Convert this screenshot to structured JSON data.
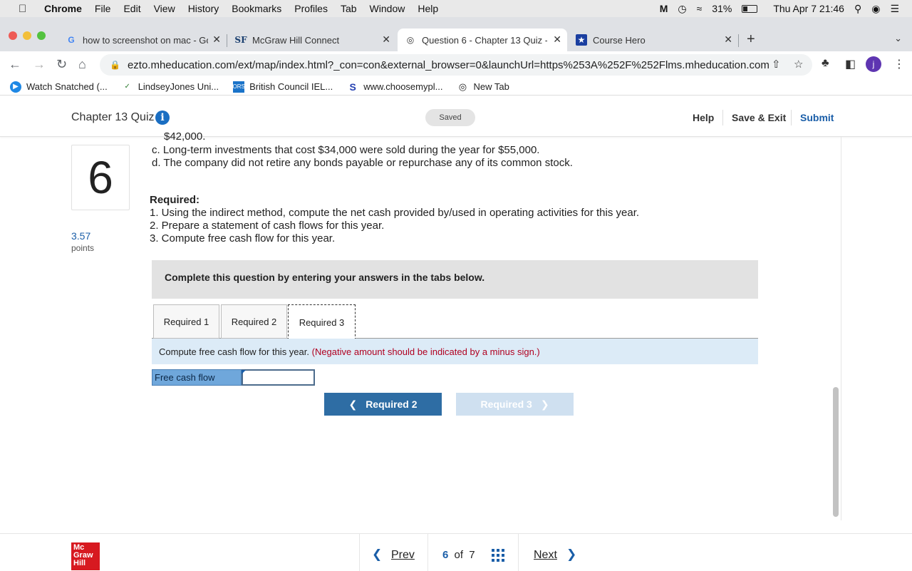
{
  "menubar": {
    "app": "Chrome",
    "items": [
      "File",
      "Edit",
      "View",
      "History",
      "Bookmarks",
      "Profiles",
      "Tab",
      "Window",
      "Help"
    ],
    "battery": "31%",
    "clock": "Thu Apr 7  21:46"
  },
  "browser": {
    "tabs": [
      {
        "title": "how to screenshot on mac - Go",
        "favicon": "G"
      },
      {
        "title": "McGraw Hill Connect",
        "favicon": "SF"
      },
      {
        "title": "Question 6 - Chapter 13 Quiz -",
        "favicon": "globe"
      },
      {
        "title": "Course Hero",
        "favicon": "star"
      }
    ],
    "url": "ezto.mheducation.com/ext/map/index.html?_con=con&external_browser=0&launchUrl=https%253A%252F%252Flms.mheducation.com...",
    "avatar_letter": "j",
    "bookmarks": [
      "Watch Snatched (...",
      "LindseyJones Uni...",
      "British Council IEL...",
      "www.choosemypl...",
      "New Tab"
    ],
    "bookmark_icons": [
      "ORS"
    ]
  },
  "quiz": {
    "title": "Chapter 13 Quiz",
    "saved_label": "Saved",
    "help": "Help",
    "save_exit": "Save & Exit",
    "submit": "Submit",
    "question_number": "6",
    "points_value": "3.57",
    "points_label": "points",
    "clipped_text": "$42,000.",
    "line_c": "c. Long-term investments that cost $34,000 were sold during the year for $55,000.",
    "line_d": "d. The company did not retire any bonds payable or repurchase any of its common stock.",
    "required_heading": "Required:",
    "required_1": "1. Using the indirect method, compute the net cash provided by/used in operating activities for this year.",
    "required_2": "2. Prepare a statement of cash flows for this year.",
    "required_3": "3. Compute free cash flow for this year.",
    "instruction": "Complete this question by entering your answers in the tabs below.",
    "tabs": [
      "Required 1",
      "Required 2",
      "Required 3"
    ],
    "prompt": "Compute free cash flow for this year.",
    "prompt_note": "(Negative amount should be indicated by a minus sign.)",
    "fcf_label": "Free cash flow",
    "fcf_value": "",
    "prev_tab_btn": "Required 2",
    "next_tab_btn": "Required 3"
  },
  "footer": {
    "logo": [
      "Mc",
      "Graw",
      "Hill"
    ],
    "prev": "Prev",
    "current": "6",
    "of": "of",
    "total": "7",
    "next": "Next"
  }
}
